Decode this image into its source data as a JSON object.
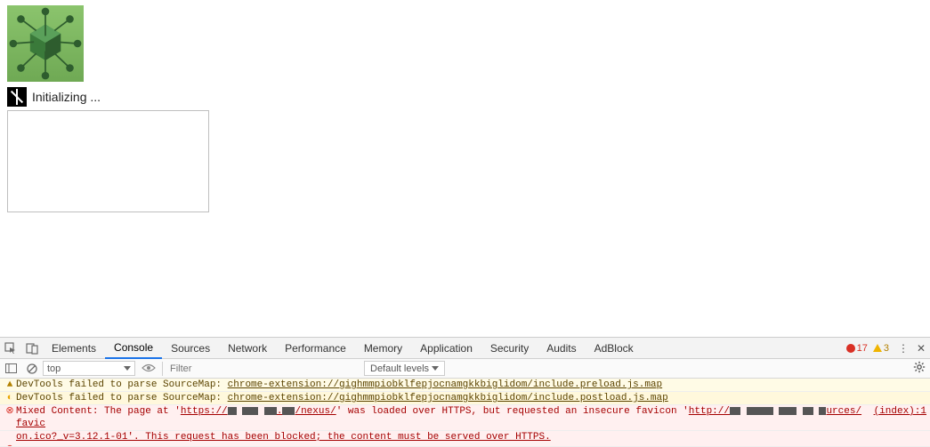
{
  "page": {
    "init_label": "Initializing ..."
  },
  "devtools": {
    "tabs": [
      "Elements",
      "Console",
      "Sources",
      "Network",
      "Performance",
      "Memory",
      "Application",
      "Security",
      "Audits",
      "AdBlock"
    ],
    "active_tab": "Console",
    "error_count": "17",
    "warn_count": "3",
    "toolbar": {
      "context": "top",
      "filter_placeholder": "Filter",
      "levels_label": "Default levels"
    },
    "logs": {
      "w1_prefix": "DevTools failed to parse SourceMap: ",
      "w1_link": "chrome-extension://gighmmpiobklfepjocnamgkkbiglidom/include.preload.js.map",
      "w2_prefix": "DevTools failed to parse SourceMap: ",
      "w2_link": "chrome-extension://gighmmpiobklfepjocnamgkkbiglidom/include.postload.js.map",
      "e1_a": "Mixed Content: The page at '",
      "e1_b": "https://",
      "e1_c": "/nexus/",
      "e1_d": "' was loaded over HTTPS, but requested an insecure favicon '",
      "e1_e": "http://",
      "e1_f": "urces/favic",
      "e1_src": "(index):1",
      "e1_line2": "on.ico?_v=3.12.1-01'. This request has been blocked; the content must be served over HTTPS."
    }
  }
}
